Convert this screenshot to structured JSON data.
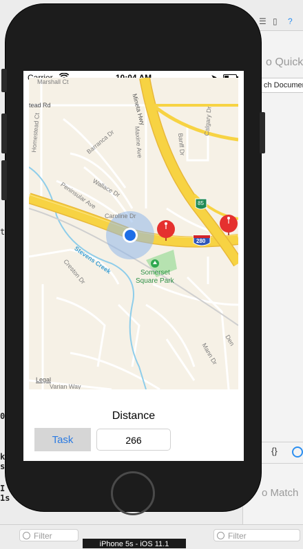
{
  "xcode": {
    "quick_help": "o Quick H",
    "search_docs": "ch Documen",
    "no_matches": "o Match",
    "braces": "{}",
    "filter_left": "Filter",
    "filter_right": "Filter",
    "device_label": "iPhone 5s - iOS 11.1",
    "left_fragments": [
      "t",
      "0",
      "k",
      "st",
      "I",
      "1s"
    ]
  },
  "status_bar": {
    "carrier": "Carrier",
    "time": "10:04 AM"
  },
  "map": {
    "labels": {
      "marshall": "Marshall Ct",
      "stead": "tead Rd",
      "mineta": "Mineta Hwy",
      "homestead_ct": "Homestead Ct",
      "barranca": "Barranca Dr",
      "maxine": "Maxine Ave",
      "banff": "Banff Dr",
      "calgary": "Calgary Dr",
      "wallace": "Wallace Dr",
      "peninsular": "Peninsular Ave",
      "caroline": "Caroline Dr",
      "stevens": "Stevens Creek",
      "creston": "Creston Dr",
      "park1": "Somerset",
      "park2": "Square Park",
      "mann": "Mann Dr",
      "den": "Den",
      "varian": "Varian Way",
      "shield85": "85",
      "shield280": "280"
    },
    "legal": "Legal"
  },
  "distance_label": "Distance",
  "task_button": "Task",
  "distance_value": "266",
  "colors": {
    "accent": "#2a7ae2",
    "highway": "#f7d343",
    "pin": "#e5312f",
    "user_dot": "#1e6ee6",
    "park": "#b6e2b0",
    "water": "#8ecdea"
  }
}
